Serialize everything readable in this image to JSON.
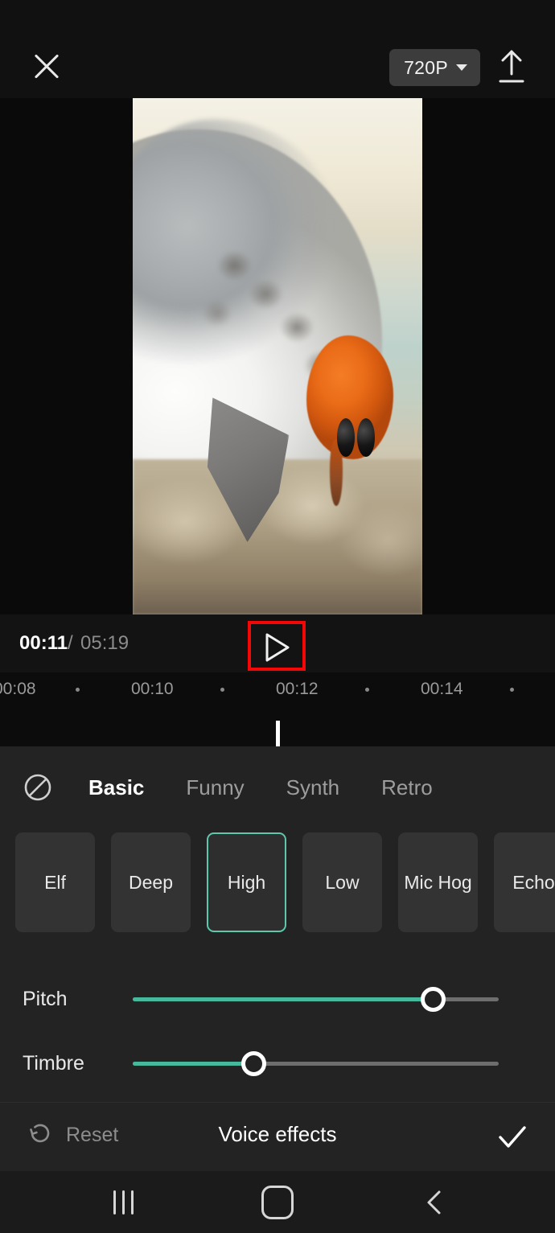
{
  "topbar": {
    "close_icon": "close-icon",
    "resolution_label": "720P",
    "resolution_caret": "chevron-down-icon",
    "export_icon": "upload-icon"
  },
  "preview": {
    "description": "Close-up video frame of a white and grey seagull head with grey beak beside a bright orange crab on sandy ground, pale cream and teal background"
  },
  "player": {
    "current_time": "00:11",
    "separator": "/",
    "total_time": "05:19",
    "play_icon": "play-icon"
  },
  "ruler": {
    "labels": [
      "00:08",
      "00:10",
      "00:12",
      "00:14"
    ],
    "playhead_position": "00:11"
  },
  "panel": {
    "none_icon": "prohibited-icon",
    "tabs": [
      {
        "label": "Basic",
        "active": true
      },
      {
        "label": "Funny",
        "active": false
      },
      {
        "label": "Synth",
        "active": false
      },
      {
        "label": "Retro",
        "active": false
      }
    ],
    "effects": [
      {
        "label": "Elf",
        "selected": false
      },
      {
        "label": "Deep",
        "selected": false
      },
      {
        "label": "High",
        "selected": true
      },
      {
        "label": "Low",
        "selected": false
      },
      {
        "label": "Mic Hog",
        "selected": false
      },
      {
        "label": "Echo",
        "selected": false
      }
    ],
    "sliders": [
      {
        "label": "Pitch",
        "percent": 82
      },
      {
        "label": "Timbre",
        "percent": 33
      }
    ],
    "accent_color": "#46b89b",
    "selected_border_color": "#5ec8ac"
  },
  "actions": {
    "reset_label": "Reset",
    "reset_icon": "undo-icon",
    "title": "Voice effects",
    "confirm_icon": "check-icon"
  },
  "navbar": {
    "recents_icon": "recents-icon",
    "home_icon": "home-icon",
    "back_icon": "back-chevron-icon"
  },
  "annotation": {
    "highlight_color": "#f30707",
    "target": "play-button"
  }
}
